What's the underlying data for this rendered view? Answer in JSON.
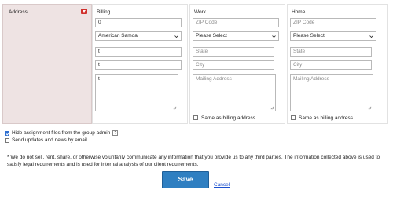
{
  "address": {
    "label": "Address"
  },
  "billing": {
    "title": "Billing",
    "zip": "0",
    "country": "American Samoa",
    "state": "t",
    "city": "t",
    "mailing": "t"
  },
  "work": {
    "title": "Work",
    "zip_placeholder": "ZIP Code",
    "country": "Please Select",
    "state_placeholder": "State",
    "city_placeholder": "City",
    "mailing_placeholder": "Mailing Address",
    "same_as_billing": "Same as billing address"
  },
  "home": {
    "title": "Home",
    "zip_placeholder": "ZIP Code",
    "country": "Please Select",
    "state_placeholder": "State",
    "city_placeholder": "City",
    "mailing_placeholder": "Mailing Address",
    "same_as_billing": "Same as billing address"
  },
  "options": {
    "hide_assignment": "Hide assignment files from the group admin",
    "help_glyph": "?",
    "send_updates": "Send updates and news by email"
  },
  "disclaimer": "* We do not sell, rent, share, or otherwise voluntarily communicate any information that you provide us to any third parties. The information collected above is used to satisfy legal requirements and is used for internal analysis of our client requirements.",
  "actions": {
    "save": "Save",
    "cancel": "Cancel"
  },
  "colors": {
    "accent": "#2f7fc1",
    "toggle": "#d0312d",
    "panel": "#eee3e3"
  }
}
